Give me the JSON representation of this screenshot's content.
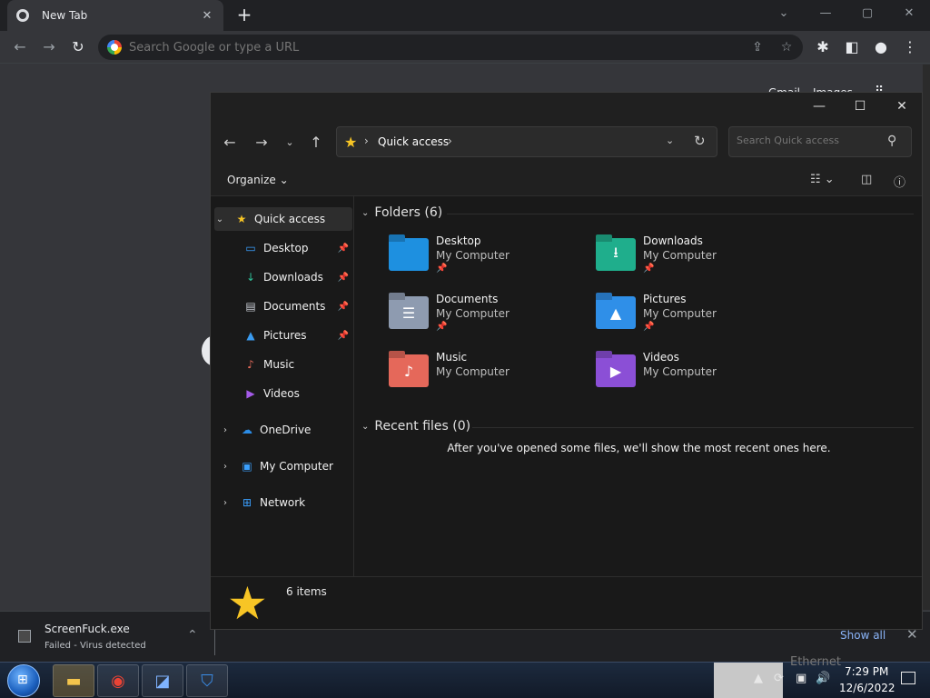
{
  "chrome": {
    "tab_title": "New Tab",
    "tab_close": "✕",
    "new_tab": "+",
    "window_controls": [
      "⌄",
      "—",
      "▢",
      "✕"
    ],
    "omnibox_placeholder": "Search Google or type a URL",
    "gmail": "Gmail",
    "images": "Images"
  },
  "downloads": {
    "file_name": "ScreenFuck.exe",
    "status": "Failed - Virus detected",
    "show_all": "Show all"
  },
  "explorer": {
    "address_crumb": "Quick access",
    "search_placeholder": "Search Quick access",
    "organize": "Organize",
    "sidebar": [
      {
        "label": "Quick access",
        "icon": "star-icon",
        "selected": true
      },
      {
        "label": "Desktop",
        "icon": "desktop-icon",
        "pinned": true
      },
      {
        "label": "Downloads",
        "icon": "download-icon",
        "pinned": true
      },
      {
        "label": "Documents",
        "icon": "document-icon",
        "pinned": true
      },
      {
        "label": "Pictures",
        "icon": "picture-icon",
        "pinned": true
      },
      {
        "label": "Music",
        "icon": "music-icon"
      },
      {
        "label": "Videos",
        "icon": "video-icon"
      },
      {
        "label": "OneDrive",
        "icon": "cloud-icon"
      },
      {
        "label": "My Computer",
        "icon": "computer-icon"
      },
      {
        "label": "Network",
        "icon": "network-icon"
      }
    ],
    "folders_heading": "Folders (6)",
    "folders": [
      {
        "name": "Desktop",
        "location": "My Computer",
        "pinned": true,
        "color": "#1e90e0"
      },
      {
        "name": "Downloads",
        "location": "My Computer",
        "pinned": true,
        "color": "#1fae8c"
      },
      {
        "name": "Documents",
        "location": "My Computer",
        "pinned": true,
        "color": "#8e9bb0"
      },
      {
        "name": "Pictures",
        "location": "My Computer",
        "pinned": true,
        "color": "#2f8fe8"
      },
      {
        "name": "Music",
        "location": "My Computer",
        "pinned": false,
        "color": "#e5685a"
      },
      {
        "name": "Videos",
        "location": "My Computer",
        "pinned": false,
        "color": "#8b4fd6"
      }
    ],
    "recent_heading": "Recent files (0)",
    "recent_empty": "After you've opened some files, we'll show the most recent ones here.",
    "status_count": "6 items"
  },
  "taskbar": {
    "ethernet": "Ethernet",
    "time": "7:29 PM",
    "date": "12/6/2022"
  },
  "colors": {
    "accent_star": "#f7c525",
    "link_blue": "#8ab4f8"
  }
}
